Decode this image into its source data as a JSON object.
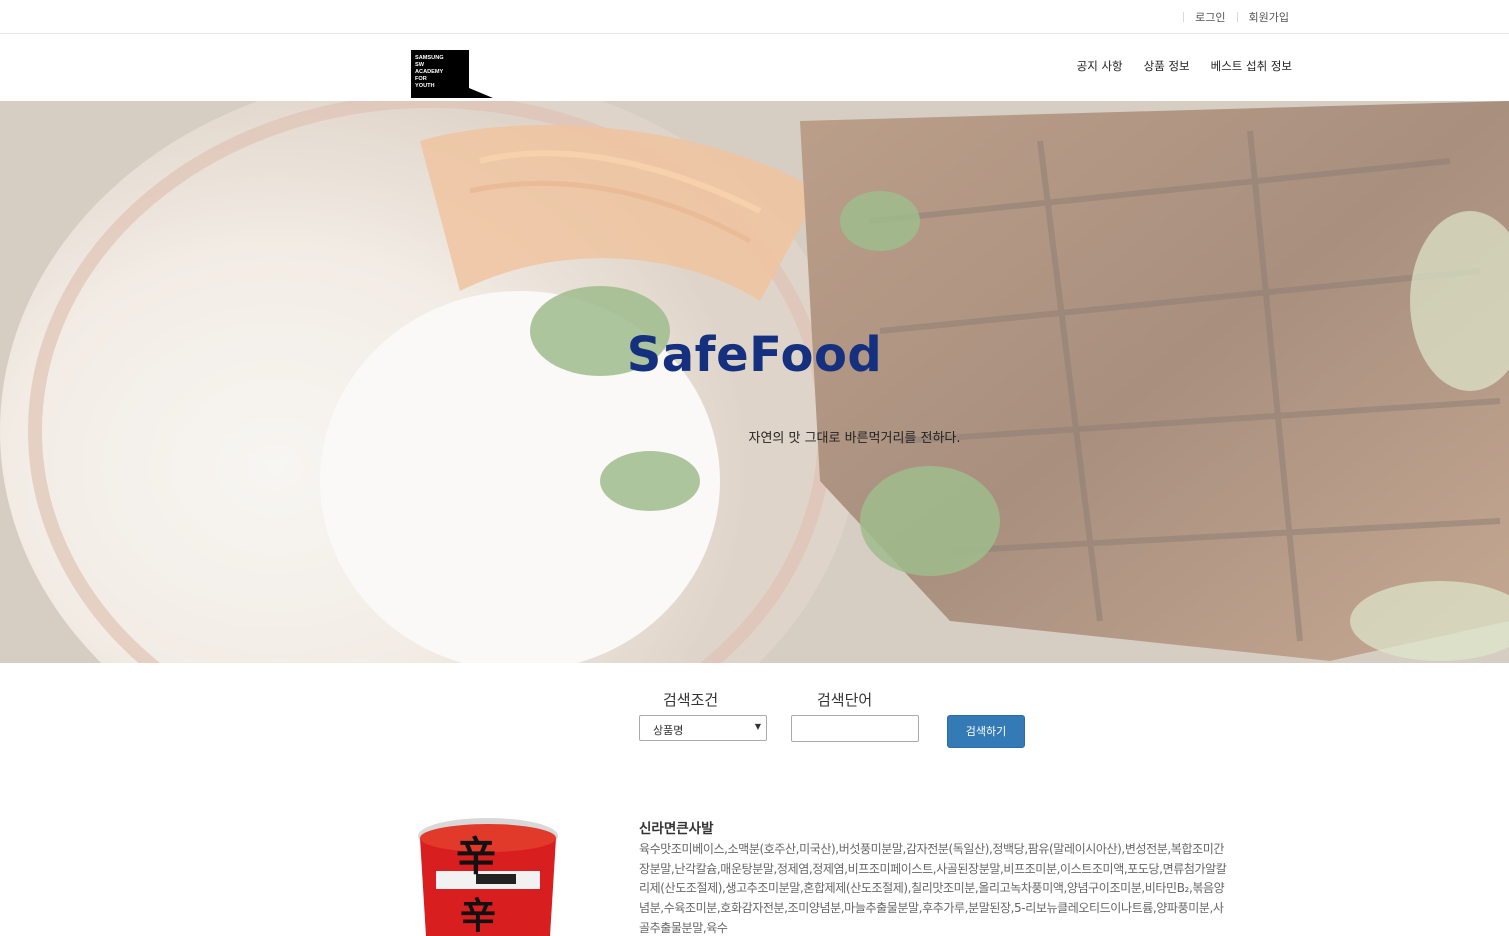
{
  "topbar": {
    "login": "로그인",
    "signup": "회원가입"
  },
  "logo": {
    "lines": [
      "SAMSUNG",
      "SW",
      "ACADEMY",
      "FOR",
      "YOUTH"
    ]
  },
  "nav": {
    "items": [
      "공지 사항",
      "상품 정보",
      "베스트 섭취 정보"
    ]
  },
  "hero": {
    "title": "SafeFood",
    "subtitle": "자연의 맛 그대로 바른먹거리를 전하다."
  },
  "search": {
    "condition_label": "검색조건",
    "keyword_label": "검색단어",
    "selected_condition": "상품명",
    "keyword_value": "",
    "button_label": "검색하기"
  },
  "product": {
    "name": "신라면큰사발",
    "description": "육수맛조미베이스,소맥분(호주산,미국산),버섯풍미분말,감자전분(독일산),정백당,팜유(말레이시아산),변성전분,복합조미간장분말,난각칼슘,매운탕분말,정제염,정제염,비프조미페이스트,사골된장분말,비프조미분,이스트조미액,포도당,면류첨가알칼리제(산도조절제),생고추조미분말,혼합제제(산도조절제),칠리맛조미분,올리고녹차풍미액,양념구이조미분,비타민B₂,볶음양념분,수육조미분,호화감자전분,조미양념분,마늘추출물분말,후추가루,분말된장,5-리보뉴클레오티드이나트륨,양파풍미분,사골추출물분말,육수",
    "image_text": "辛"
  },
  "colors": {
    "title": "#14307e",
    "button": "#337ab7"
  }
}
